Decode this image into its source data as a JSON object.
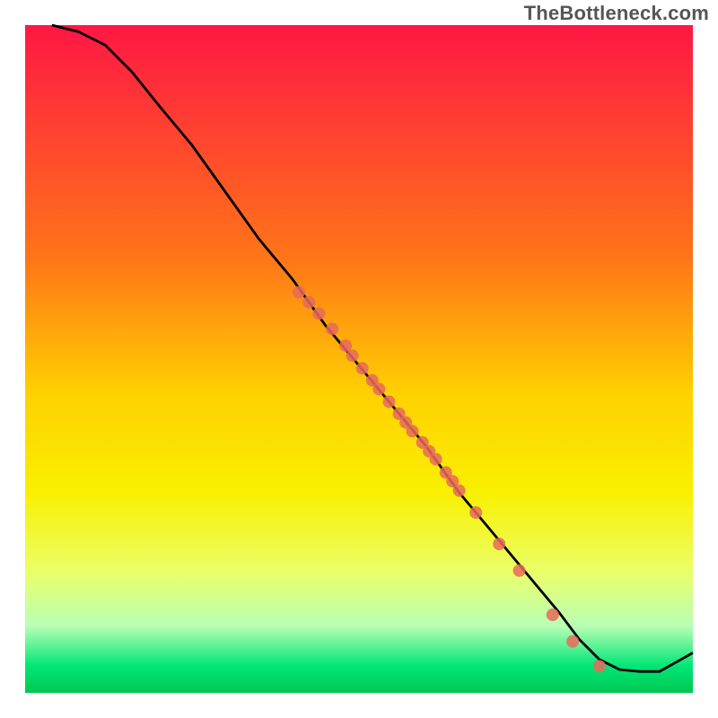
{
  "watermark": "TheBottleneck.com",
  "chart_data": {
    "type": "line",
    "title": "",
    "xlabel": "",
    "ylabel": "",
    "xlim": [
      0,
      100
    ],
    "ylim": [
      0,
      100
    ],
    "grid": false,
    "background": {
      "gradient_stops": [
        {
          "offset": 0,
          "color": "#ff1744"
        },
        {
          "offset": 35,
          "color": "#ff7518"
        },
        {
          "offset": 55,
          "color": "#ffd000"
        },
        {
          "offset": 70,
          "color": "#f9f000"
        },
        {
          "offset": 82,
          "color": "#eaff6a"
        },
        {
          "offset": 90,
          "color": "#b8ffb5"
        },
        {
          "offset": 96,
          "color": "#00e676"
        },
        {
          "offset": 100,
          "color": "#00c853"
        }
      ]
    },
    "series": [
      {
        "name": "curve",
        "type": "line",
        "color": "#000000",
        "x": [
          4,
          8,
          12,
          16,
          20,
          25,
          30,
          35,
          40,
          45,
          50,
          55,
          60,
          65,
          70,
          75,
          80,
          83,
          86,
          89,
          92,
          95,
          100
        ],
        "y": [
          100,
          99,
          97,
          93,
          88,
          82,
          75,
          68,
          62,
          55,
          49,
          43,
          37,
          30,
          24,
          18,
          12,
          8,
          5,
          3.5,
          3.2,
          3.2,
          6
        ]
      },
      {
        "name": "points",
        "type": "scatter",
        "color": "#e86a5a",
        "x": [
          41,
          42.5,
          44,
          46,
          48,
          49,
          50.5,
          52,
          53,
          54.5,
          56,
          57,
          58,
          59.5,
          60.5,
          61.5,
          63,
          64,
          65,
          67.5,
          71,
          74,
          79,
          82,
          86
        ],
        "y": [
          60,
          58.5,
          56.8,
          54.5,
          52,
          50.5,
          48.6,
          46.8,
          45.5,
          43.6,
          41.8,
          40.5,
          39.2,
          37.5,
          36.2,
          35,
          33,
          31.7,
          30.3,
          27,
          22.3,
          18.3,
          11.7,
          7.7,
          4
        ]
      }
    ]
  }
}
